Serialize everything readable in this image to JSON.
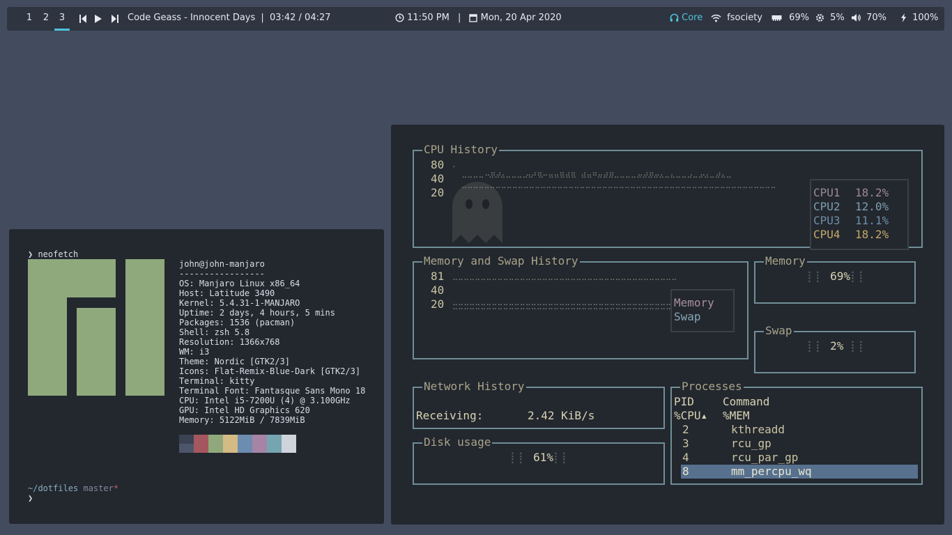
{
  "bar": {
    "workspaces": [
      "1",
      "2",
      "3"
    ],
    "active_workspace": "3",
    "track": "Code Geass - Innocent Days",
    "separator": "|",
    "position": "03:42 / 04:27",
    "time": "11:50 PM",
    "date": "Mon, 20 Apr 2020",
    "headphones": "Core",
    "wifi": "fsociety",
    "memory": "69%",
    "cpu": "5%",
    "volume": "70%",
    "battery": "100%",
    "accent": "#4fc3d9"
  },
  "neofetch": {
    "command": "neofetch",
    "user": "john@john-manjaro",
    "rule": "-----------------",
    "info": [
      {
        "key": "OS",
        "value": "Manjaro Linux x86_64"
      },
      {
        "key": "Host",
        "value": "Latitude 3490"
      },
      {
        "key": "Kernel",
        "value": "5.4.31-1-MANJARO"
      },
      {
        "key": "Uptime",
        "value": "2 days, 4 hours, 5 mins"
      },
      {
        "key": "Packages",
        "value": "1536 (pacman)"
      },
      {
        "key": "Shell",
        "value": "zsh 5.8"
      },
      {
        "key": "Resolution",
        "value": "1366x768"
      },
      {
        "key": "WM",
        "value": "i3"
      },
      {
        "key": "Theme",
        "value": "Nordic [GTK2/3]"
      },
      {
        "key": "Icons",
        "value": "Flat-Remix-Blue-Dark [GTK2/3]"
      },
      {
        "key": "Terminal",
        "value": "kitty"
      },
      {
        "key": "Terminal Font",
        "value": "Fantasque Sans Mono 18"
      },
      {
        "key": "CPU",
        "value": "Intel i5-7200U (4) @ 3.100GHz"
      },
      {
        "key": "GPU",
        "value": "Intel HD Graphics 620"
      },
      {
        "key": "Memory",
        "value": "5122MiB / 7839MiB"
      }
    ],
    "palette_top": [
      "#3b4252",
      "#a55760",
      "#8fa97c",
      "#d4ba84",
      "#6c8cb0",
      "#a584a5",
      "#75a5b0",
      "#cfd4dc"
    ],
    "palette_bottom": [
      "#4c566a",
      "#a55760",
      "#8fa97c",
      "#d4ba84",
      "#6c8cb0",
      "#a584a5",
      "#75a5b0",
      "#cfd4dc"
    ],
    "prompt_dir": "~/dotfiles",
    "prompt_branch": "master",
    "prompt_dirty": "*",
    "prompt_symbol": "❯"
  },
  "btop": {
    "cpu_history": {
      "title": "CPU History",
      "y_ticks": [
        "80",
        "40",
        "20"
      ],
      "cores": [
        {
          "name": "CPU1",
          "value": "18.2%",
          "color": "#9a8a96"
        },
        {
          "name": "CPU2",
          "value": "12.0%",
          "color": "#7d9fb0"
        },
        {
          "name": "CPU3",
          "value": "11.1%",
          "color": "#6e8fa8"
        },
        {
          "name": "CPU4",
          "value": "18.2%",
          "color": "#c4a96a"
        }
      ]
    },
    "mem_history": {
      "title": "Memory and Swap History",
      "y_ticks": [
        "81",
        "40",
        "20"
      ],
      "legend": [
        {
          "name": "Memory",
          "color": "#a88fa3"
        },
        {
          "name": "Swap",
          "color": "#86a8b8"
        }
      ]
    },
    "memory": {
      "title": "Memory",
      "value": "69%"
    },
    "swap": {
      "title": "Swap",
      "value": "2%"
    },
    "network": {
      "title": "Network History",
      "label": "Receiving:",
      "value": "2.42 KiB/s"
    },
    "disk": {
      "title": "Disk usage",
      "value": "61%"
    },
    "processes": {
      "title": "Processes",
      "headers": [
        "PID",
        "Command"
      ],
      "headers2": [
        "%CPU▴",
        "%MEM"
      ],
      "rows": [
        {
          "pid": "2",
          "cmd": "kthreadd"
        },
        {
          "pid": "3",
          "cmd": "rcu_gp"
        },
        {
          "pid": "4",
          "cmd": "rcu_par_gp"
        },
        {
          "pid": "8",
          "cmd": "mm_percpu_wq"
        }
      ],
      "selected_row": 3
    }
  }
}
